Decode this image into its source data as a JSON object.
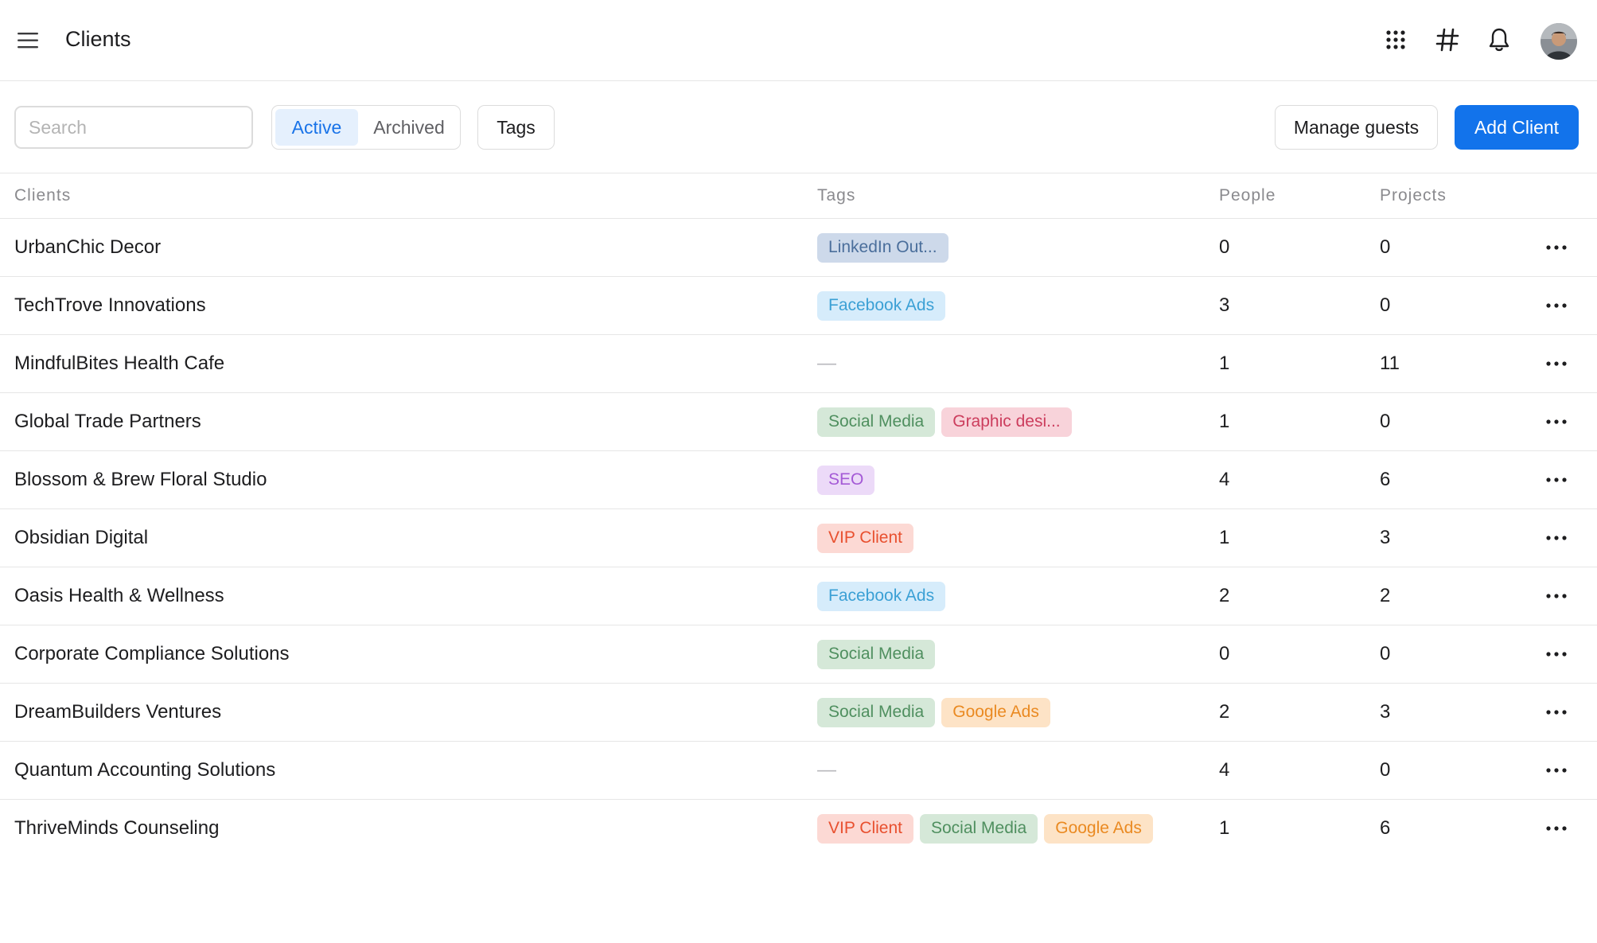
{
  "header": {
    "title": "Clients",
    "icons": [
      "menu-icon",
      "apps-grid-icon",
      "hashtag-icon",
      "bell-icon",
      "avatar"
    ]
  },
  "toolbar": {
    "search_placeholder": "Search",
    "segment": {
      "active": "Active",
      "archived": "Archived",
      "selected": "Active"
    },
    "tags_label": "Tags",
    "manage_guests_label": "Manage guests",
    "add_client_label": "Add Client"
  },
  "table": {
    "headers": {
      "clients": "Clients",
      "tags": "Tags",
      "people": "People",
      "projects": "Projects"
    },
    "empty_tag": "—",
    "rows": [
      {
        "name": "UrbanChic Decor",
        "tags": [
          {
            "label": "LinkedIn Out...",
            "color": "blue-gray"
          }
        ],
        "people": "0",
        "projects": "0"
      },
      {
        "name": "TechTrove Innovations",
        "tags": [
          {
            "label": "Facebook Ads",
            "color": "light-blue"
          }
        ],
        "people": "3",
        "projects": "0"
      },
      {
        "name": "MindfulBites Health Cafe",
        "tags": [],
        "people": "1",
        "projects": "11"
      },
      {
        "name": "Global Trade Partners",
        "tags": [
          {
            "label": "Social Media",
            "color": "green"
          },
          {
            "label": "Graphic desi...",
            "color": "pink"
          }
        ],
        "people": "1",
        "projects": "0"
      },
      {
        "name": "Blossom & Brew Floral Studio",
        "tags": [
          {
            "label": "SEO",
            "color": "purple"
          }
        ],
        "people": "4",
        "projects": "6"
      },
      {
        "name": "Obsidian Digital",
        "tags": [
          {
            "label": "VIP Client",
            "color": "red"
          }
        ],
        "people": "1",
        "projects": "3"
      },
      {
        "name": "Oasis Health & Wellness",
        "tags": [
          {
            "label": "Facebook Ads",
            "color": "light-blue"
          }
        ],
        "people": "2",
        "projects": "2"
      },
      {
        "name": "Corporate Compliance Solutions",
        "tags": [
          {
            "label": "Social Media",
            "color": "green"
          }
        ],
        "people": "0",
        "projects": "0"
      },
      {
        "name": "DreamBuilders Ventures",
        "tags": [
          {
            "label": "Social Media",
            "color": "green"
          },
          {
            "label": "Google Ads",
            "color": "orange"
          }
        ],
        "people": "2",
        "projects": "3"
      },
      {
        "name": "Quantum Accounting Solutions",
        "tags": [],
        "people": "4",
        "projects": "0"
      },
      {
        "name": "ThriveMinds Counseling",
        "tags": [
          {
            "label": "VIP Client",
            "color": "red"
          },
          {
            "label": "Social Media",
            "color": "green"
          },
          {
            "label": "Google Ads",
            "color": "orange"
          }
        ],
        "people": "1",
        "projects": "6"
      }
    ]
  },
  "colors": {
    "primary": "#1273eb",
    "segment_active_bg": "#e5f0fd",
    "segment_active_text": "#1973e8"
  }
}
